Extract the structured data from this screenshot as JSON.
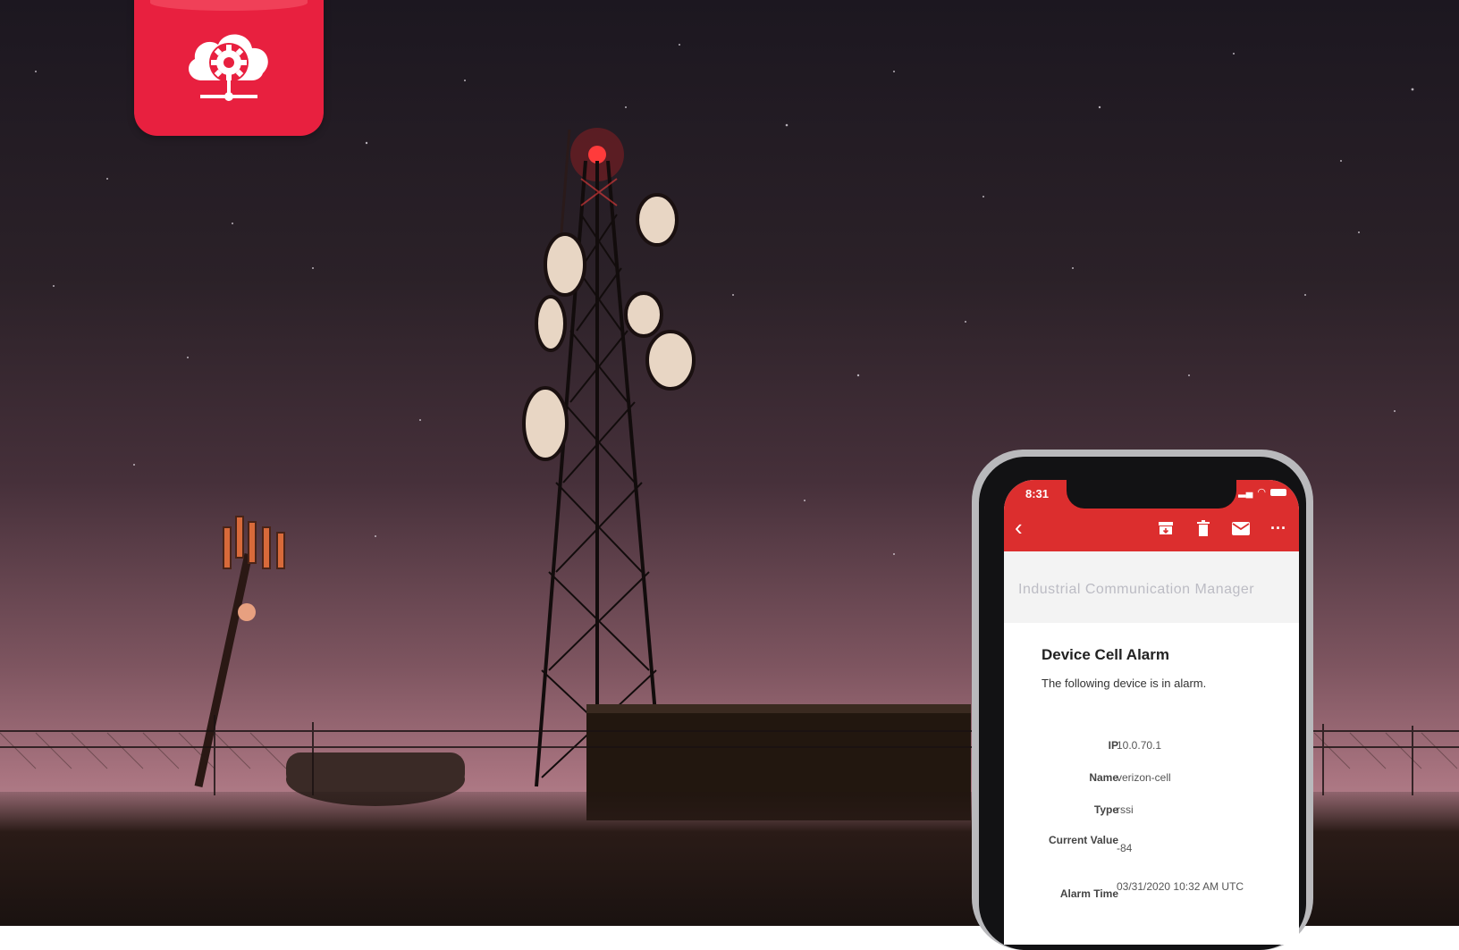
{
  "app_icon": {
    "icon": "cloud-gear-network-icon",
    "color": "#e8203f"
  },
  "phone": {
    "status_time": "8:31",
    "appbar_color": "#dc2e2e",
    "actions": [
      "back-icon",
      "archive-icon",
      "trash-icon",
      "mail-icon",
      "more-icon"
    ],
    "email_brand": "Industrial Communication Manager",
    "title": "Device Cell Alarm",
    "description": "The following device is in alarm.",
    "fields": [
      {
        "label": "IP",
        "value": "10.0.70.1"
      },
      {
        "label": "Name",
        "value": "verizon-cell"
      },
      {
        "label": "Type",
        "value": "rssi"
      },
      {
        "label": "Current Value",
        "value": "-84"
      },
      {
        "label": "Alarm Time",
        "value": "03/31/2020 10:32 AM UTC"
      }
    ]
  }
}
